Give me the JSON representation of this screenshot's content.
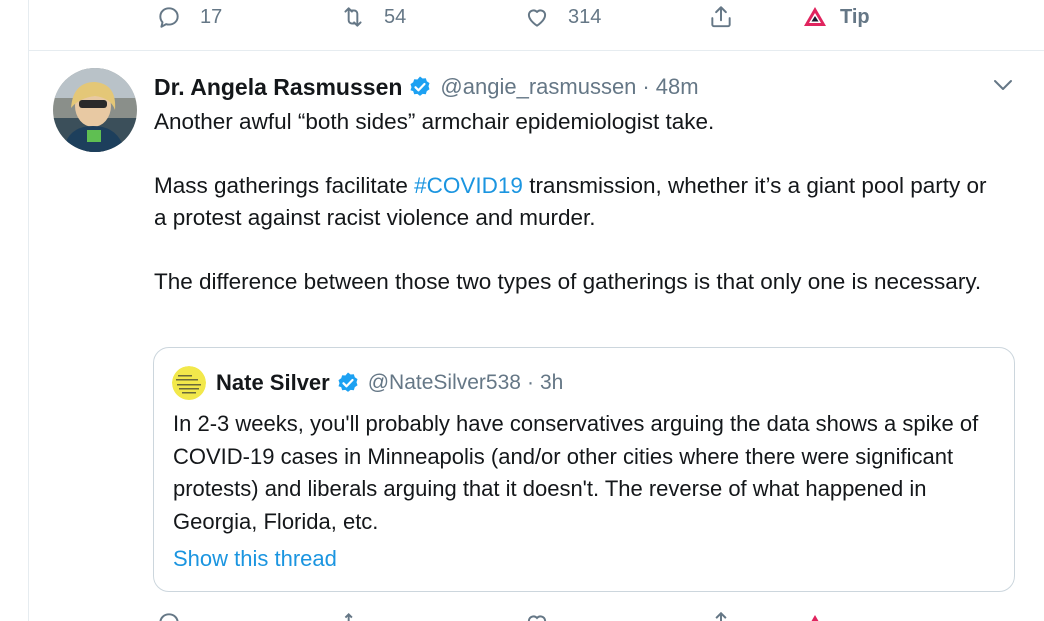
{
  "top_actions": {
    "reply_count": "17",
    "retweet_count": "54",
    "like_count": "314",
    "tip_label": "Tip"
  },
  "tweet": {
    "author_name": "Dr. Angela Rasmussen",
    "handle": "@angie_rasmussen",
    "separator": "·",
    "time": "48m",
    "para1": "Another awful “both sides” armchair epidemiologist take.",
    "para2_before": "Mass gatherings facilitate ",
    "para2_hashtag": "#COVID19",
    "para2_after": " transmission, whether it’s a giant pool party or a protest against racist violence and murder.",
    "para3": "The difference between those two types of gatherings is that only one is necessary."
  },
  "quoted_tweet": {
    "author_name": "Nate Silver",
    "handle": "@NateSilver538",
    "separator": "·",
    "time": "3h",
    "text": "In 2-3 weeks, you'll probably have conservatives arguing the data shows a spike of COVID-19 cases in Minneapolis (and/or other cities where there were significant protests) and liberals arguing that it doesn't. The reverse of what happened in Georgia, Florida, etc.",
    "show_thread": "Show this thread"
  },
  "colors": {
    "link": "#1b95e0",
    "verified": "#1da1f2",
    "muted": "#657786",
    "border": "#e6ecf0",
    "tip_icon": "#e0245e"
  },
  "icons": [
    "reply-icon",
    "retweet-icon",
    "like-icon",
    "share-icon",
    "tip-icon",
    "verified-badge-icon",
    "chevron-down-icon"
  ]
}
